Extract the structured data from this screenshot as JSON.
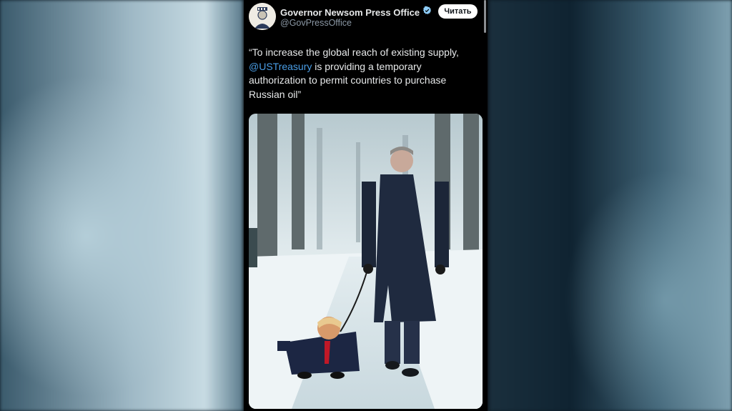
{
  "tweet": {
    "author_name": "Governor Newsom Press Office",
    "author_handle": "@GovPressOffice",
    "verified_icon": "verified-badge-icon",
    "follow_label": "Читать",
    "text_before_mention": "“To increase the global reach of existing supply, ",
    "mention": "@USTreasury",
    "text_after_mention": " is providing a temporary authorization to permit countries to purchase Russian oil”"
  },
  "colors": {
    "mention": "#4a9ee6",
    "verified": "#8ecdf8",
    "tweet_bg": "#000000"
  }
}
